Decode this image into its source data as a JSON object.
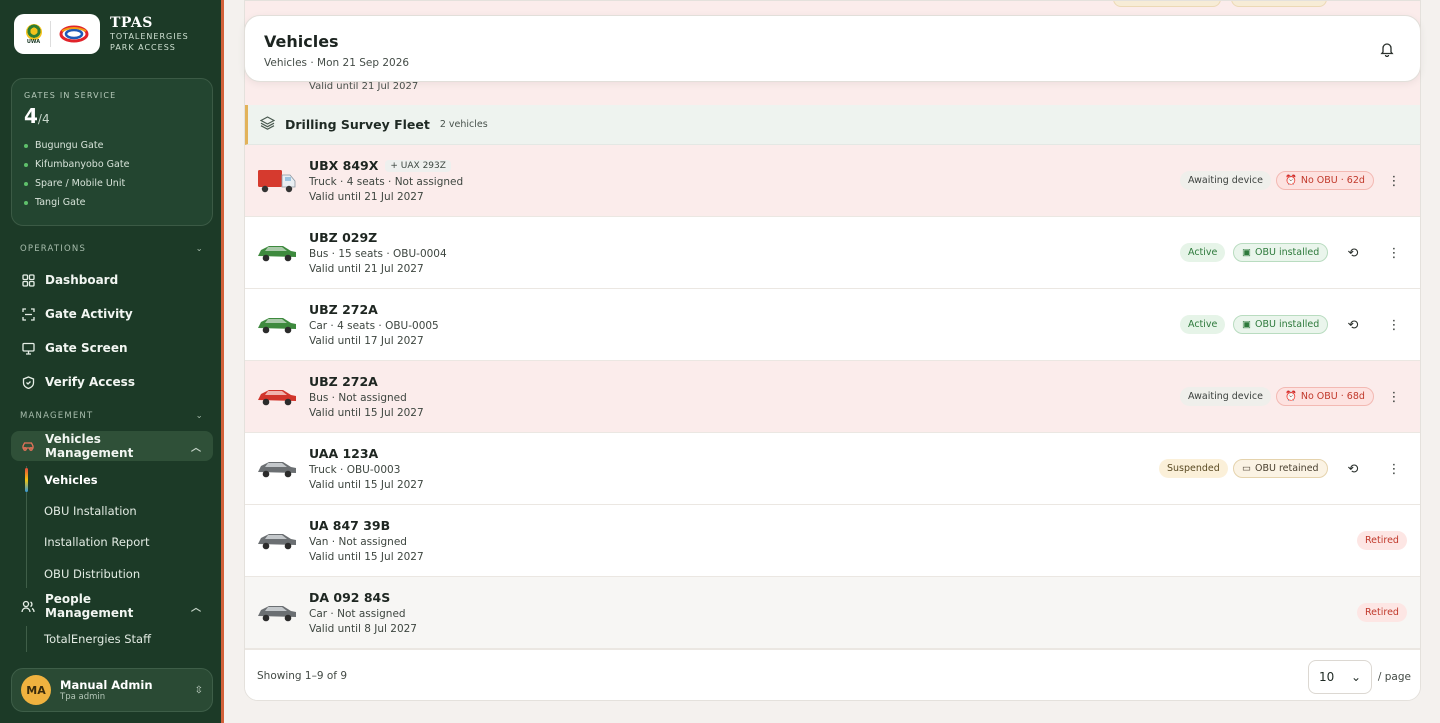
{
  "brand": {
    "name": "TPAS",
    "subtitle_line1": "TOTALENERGIES",
    "subtitle_line2": "PARK ACCESS",
    "uwa_text": "UWA"
  },
  "gates": {
    "label": "GATES IN SERVICE",
    "count": "4",
    "total": "/4",
    "list": [
      "Bugungu Gate",
      "Kifumbanyobo Gate",
      "Spare / Mobile Unit",
      "Tangi Gate"
    ]
  },
  "nav": {
    "operations_label": "OPERATIONS",
    "operations": [
      "Dashboard",
      "Gate Activity",
      "Gate Screen",
      "Verify Access"
    ],
    "management_label": "MANAGEMENT",
    "vehicles_management": "Vehicles Management",
    "vehicles_sub": [
      "Vehicles",
      "OBU Installation",
      "Installation Report",
      "OBU Distribution"
    ],
    "people_management": "People Management",
    "people_sub": [
      "TotalEnergies Staff"
    ]
  },
  "user": {
    "initials": "MA",
    "name": "Manual Admin",
    "role": "Tpa admin"
  },
  "header": {
    "title": "Vehicles",
    "subtitle": "Vehicles · Mon 21 Sep 2026"
  },
  "prev_row": {
    "valid": "Valid until 21 Jul 2027"
  },
  "fleet": {
    "name": "Drilling Survey Fleet",
    "count": "2 vehicles"
  },
  "rows": [
    {
      "plate": "UBX 849X",
      "alias": "+ UAX 293Z",
      "details": "Truck · 4 seats · Not assigned",
      "valid": "Valid until 21 Jul 2027",
      "status": "Awaiting device",
      "obu": "No OBU · 62d"
    },
    {
      "plate": "UBZ 029Z",
      "details": "Bus · 15 seats · OBU-0004",
      "valid": "Valid until 21 Jul 2027",
      "status": "Active",
      "obu": "OBU installed"
    },
    {
      "plate": "UBZ 272A",
      "details": "Car · 4 seats · OBU-0005",
      "valid": "Valid until 17 Jul 2027",
      "status": "Active",
      "obu": "OBU installed"
    },
    {
      "plate": "UBZ 272A",
      "details": "Bus · Not assigned",
      "valid": "Valid until 15 Jul 2027",
      "status": "Awaiting device",
      "obu": "No OBU · 68d"
    },
    {
      "plate": "UAA 123A",
      "details": "Truck · OBU-0003",
      "valid": "Valid until 15 Jul 2027",
      "status": "Suspended",
      "obu": "OBU retained"
    },
    {
      "plate": "UA 847 39B",
      "details": "Van · Not assigned",
      "valid": "Valid until 15 Jul 2027",
      "status": "Retired"
    },
    {
      "plate": "DA 092 84S",
      "details": "Car · Not assigned",
      "valid": "Valid until 8 Jul 2027",
      "status": "Retired"
    }
  ],
  "footer": {
    "showing": "Showing 1–9 of 9",
    "page_size": "10",
    "per_page": "/ page"
  },
  "colors": {
    "sidebar_bg": "#1c3a27",
    "accent": "#d2613a",
    "alert_row": "#fbeceb",
    "active_green": "#2e7a3c",
    "retired_red": "#c0392b"
  }
}
